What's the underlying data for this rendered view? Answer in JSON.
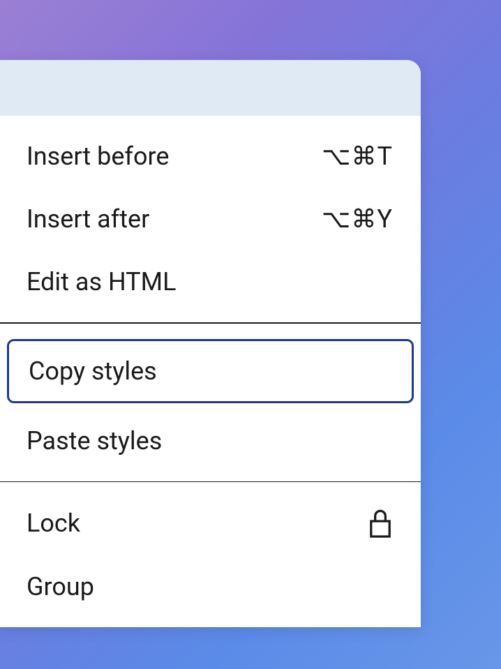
{
  "menu": {
    "sections": [
      {
        "items": [
          {
            "label": "Insert before",
            "shortcut": "⌥⌘T"
          },
          {
            "label": "Insert after",
            "shortcut": "⌥⌘Y"
          },
          {
            "label": "Edit as HTML",
            "shortcut": ""
          }
        ]
      },
      {
        "items": [
          {
            "label": "Copy styles",
            "shortcut": "",
            "focused": true
          },
          {
            "label": "Paste styles",
            "shortcut": ""
          }
        ]
      },
      {
        "items": [
          {
            "label": "Lock",
            "shortcut": "",
            "icon": "lock"
          },
          {
            "label": "Group",
            "shortcut": ""
          }
        ]
      }
    ]
  }
}
